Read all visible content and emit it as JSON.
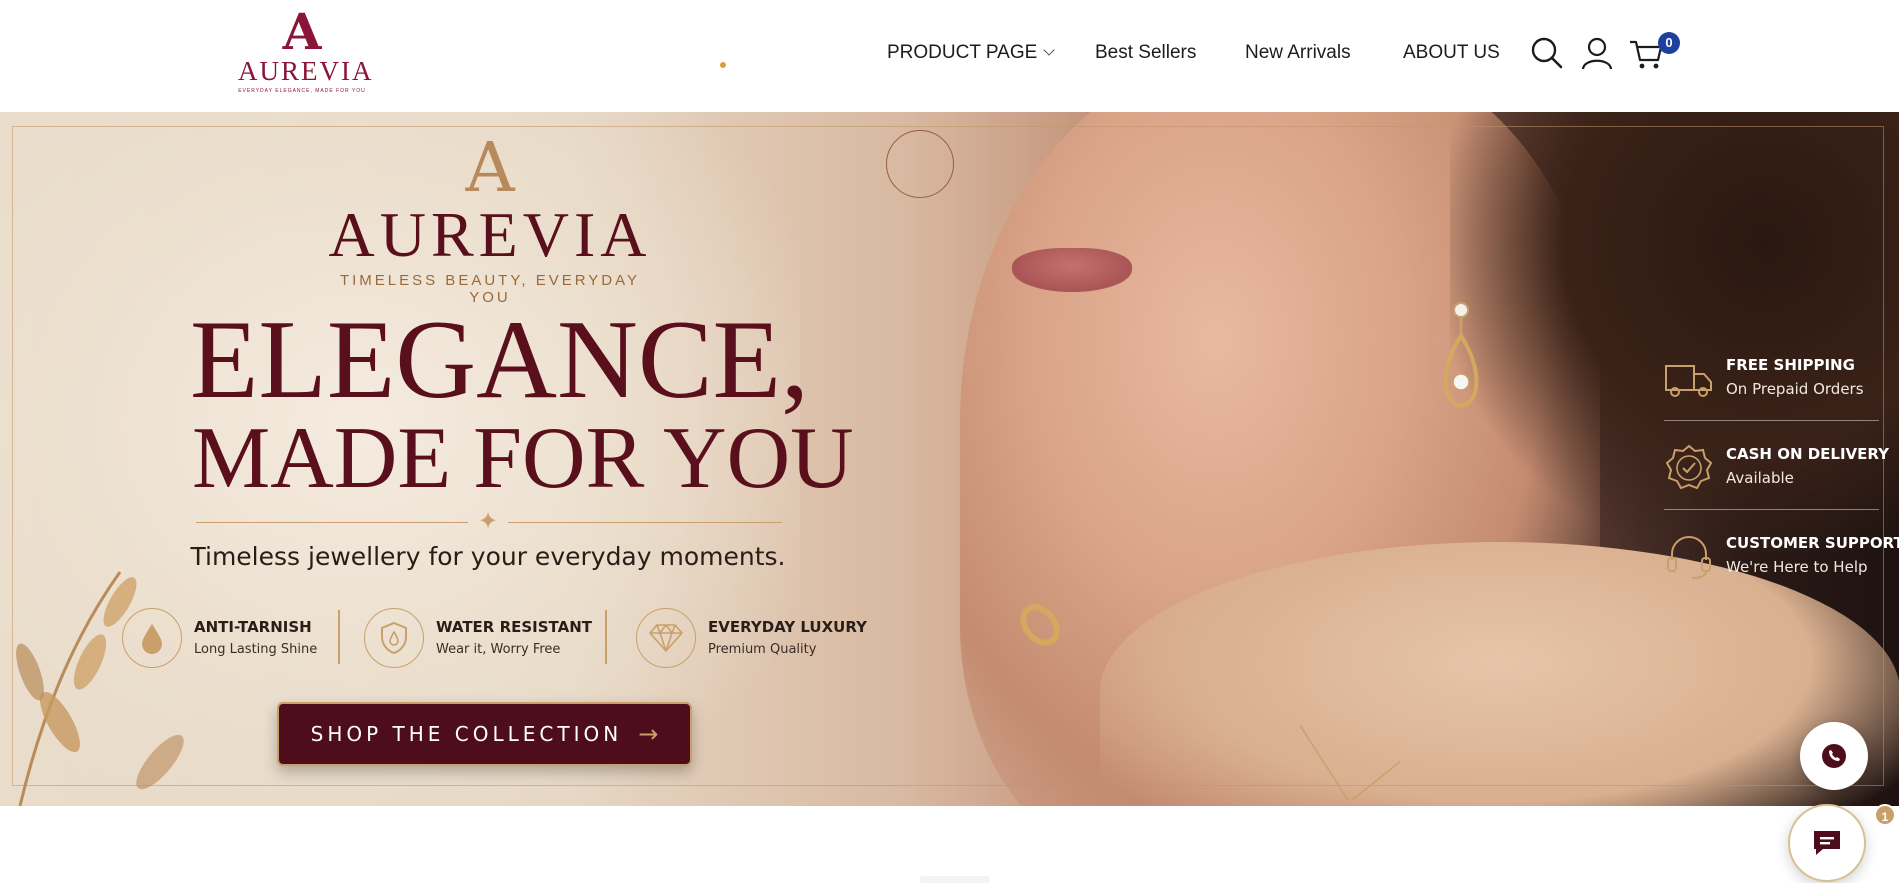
{
  "header": {
    "logo": {
      "letter": "A",
      "name": "AUREVIA",
      "tagline": "EVERYDAY ELEGANCE, MADE FOR YOU"
    },
    "nav": [
      {
        "label": "PRODUCT PAGE",
        "has_dropdown": true
      },
      {
        "label": "Best Sellers"
      },
      {
        "label": "New Arrivals"
      },
      {
        "label": "ABOUT US"
      }
    ],
    "icons": [
      "search-icon",
      "account-icon",
      "cart-icon"
    ],
    "cart_count": "0"
  },
  "hero": {
    "logo_letter": "A",
    "brand": "AUREVIA",
    "brand_tagline": "TIMELESS BEAUTY, EVERYDAY YOU",
    "headline_line1": "ELEGANCE,",
    "headline_line2": "MADE FOR YOU",
    "subheadline": "Timeless jewellery for your everyday moments.",
    "features": [
      {
        "icon": "droplet-icon",
        "title": "ANTI-TARNISH",
        "subtitle": "Long Lasting Shine"
      },
      {
        "icon": "shield-drop-icon",
        "title": "WATER RESISTANT",
        "subtitle": "Wear it, Worry Free"
      },
      {
        "icon": "diamond-icon",
        "title": "EVERYDAY LUXURY",
        "subtitle": "Premium Quality"
      }
    ],
    "cta_label": "SHOP THE COLLECTION",
    "side_features": [
      {
        "icon": "truck-icon",
        "title": "FREE SHIPPING",
        "subtitle": "On Prepaid Orders"
      },
      {
        "icon": "badge-check-icon",
        "title": "CASH ON DELIVERY",
        "subtitle": "Available"
      },
      {
        "icon": "headset-icon",
        "title": "CUSTOMER SUPPORT",
        "subtitle": "We're Here to Help"
      }
    ]
  },
  "widgets": {
    "chat_badge": "1"
  },
  "colors": {
    "maroon": "#5a0f1c",
    "gold": "#c9a06a",
    "badge_blue": "#1f3f9c"
  }
}
